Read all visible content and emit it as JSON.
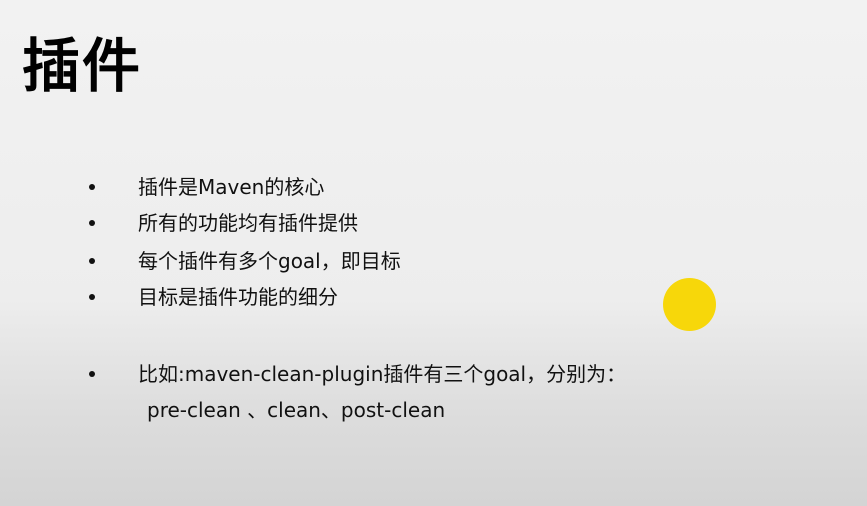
{
  "slide": {
    "title": "插件",
    "bullets": [
      "插件是Maven的核心",
      "所有的功能均有插件提供",
      "每个插件有多个goal，即目标",
      "目标是插件功能的细分",
      "比如:maven-clean-plugin插件有三个goal，分别为："
    ],
    "bullet_continuation": "pre-clean 、clean、post-clean"
  },
  "colors": {
    "cursor_highlight": "#f7d70a",
    "background_top": "#f2f2f2",
    "background_bottom": "#d4d4d4"
  },
  "icons": {
    "bullet": "bullet-dot",
    "cursor": "cursor-highlight-circle"
  }
}
